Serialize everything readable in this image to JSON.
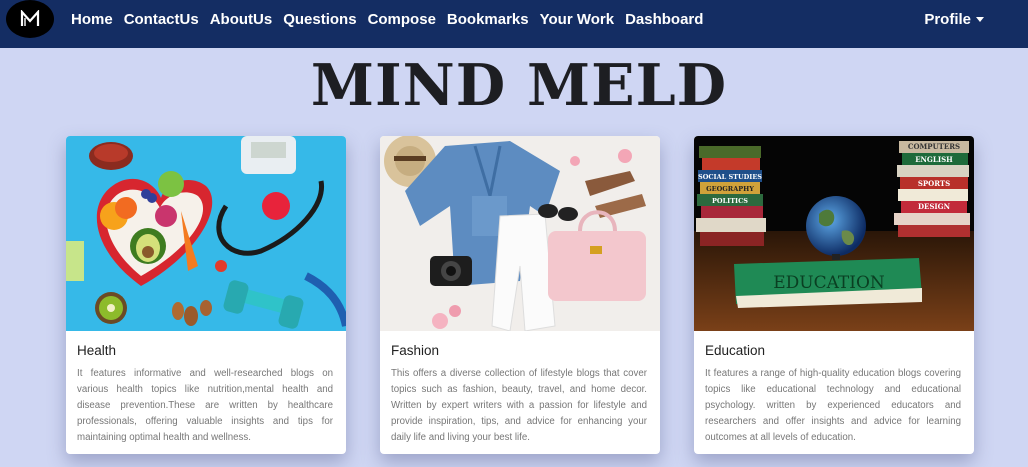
{
  "nav": {
    "logo_letter": "M",
    "links": [
      "Home",
      "ContactUs",
      "AboutUs",
      "Questions",
      "Compose",
      "Bookmarks",
      "Your Work",
      "Dashboard"
    ],
    "profile": "Profile"
  },
  "site_title": "MIND MELD",
  "cards": [
    {
      "title": "Health",
      "text": "It features informative and well-researched blogs on various health topics like nutrition,mental health and disease prevention.These are written by healthcare professionals, offering valuable insights and tips for maintaining optimal health and wellness."
    },
    {
      "title": "Fashion",
      "text": "This offers a diverse collection of lifestyle blogs that cover topics such as fashion, beauty, travel, and home decor. Written by expert writers with a passion for lifestyle and provide inspiration, tips, and advice for enhancing your daily life and living your best life."
    },
    {
      "title": "Education",
      "text": "It features a range of high-quality education blogs covering topics like educational technology and educational psychology. written by experienced educators and researchers and offer insights and advice for learning outcomes at all levels of education.",
      "book_labels": [
        "COMPUTERS",
        "ENGLISH",
        "SPORTS",
        "SOCIAL STUDIES",
        "GEOGRAPHY",
        "POLITICS",
        "DESIGN",
        "EDUCATION"
      ]
    }
  ],
  "colors": {
    "navbar": "#142d63",
    "background": "#cfd6f3",
    "title": "#1d1e22"
  }
}
